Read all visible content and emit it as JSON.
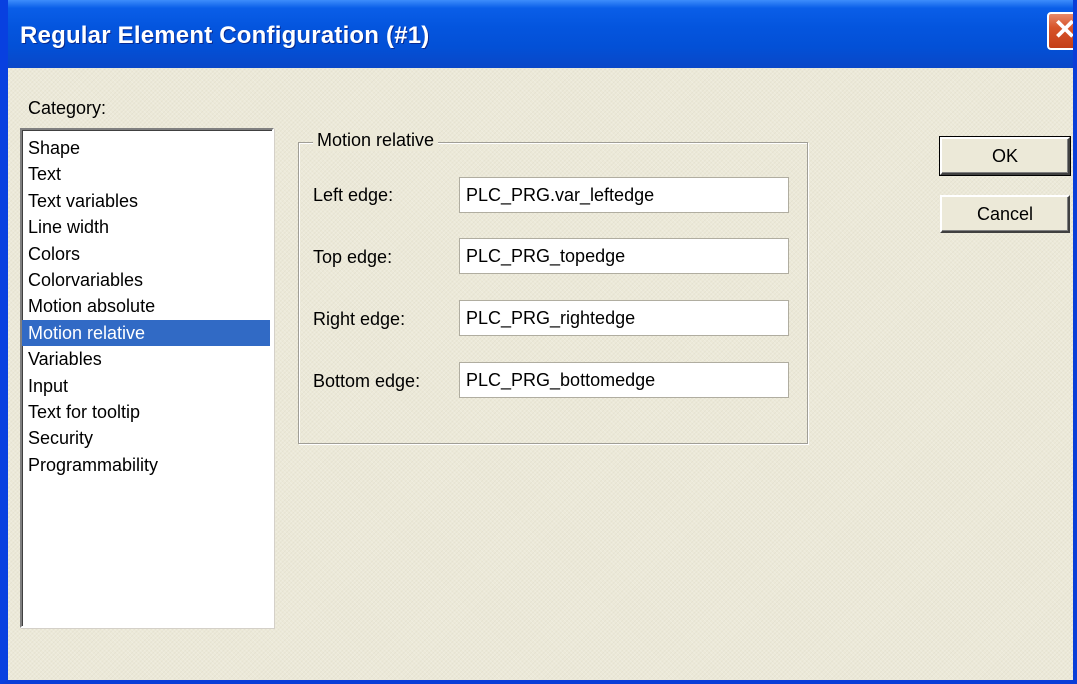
{
  "window": {
    "title": "Regular Element Configuration (#1)",
    "close_glyph": "✕"
  },
  "category": {
    "label": "Category:",
    "items": [
      "Shape",
      "Text",
      "Text variables",
      "Line width",
      "Colors",
      "Colorvariables",
      "Motion absolute",
      "Motion relative",
      "Variables",
      "Input",
      "Text for tooltip",
      "Security",
      "Programmability"
    ],
    "selected": "Motion relative"
  },
  "motion": {
    "group_title": "Motion relative",
    "fields": [
      {
        "label": "Left edge:",
        "value": "PLC_PRG.var_leftedge"
      },
      {
        "label": "Top edge:",
        "value": "PLC_PRG_topedge"
      },
      {
        "label": "Right edge:",
        "value": "PLC_PRG_rightedge"
      },
      {
        "label": "Bottom edge:",
        "value": "PLC_PRG_bottomedge"
      }
    ]
  },
  "buttons": {
    "ok": "OK",
    "cancel": "Cancel"
  },
  "colors": {
    "titlebar": "#0455de",
    "selection": "#316ac5",
    "dialog_bg": "#ece9d8",
    "close": "#d7542a"
  }
}
